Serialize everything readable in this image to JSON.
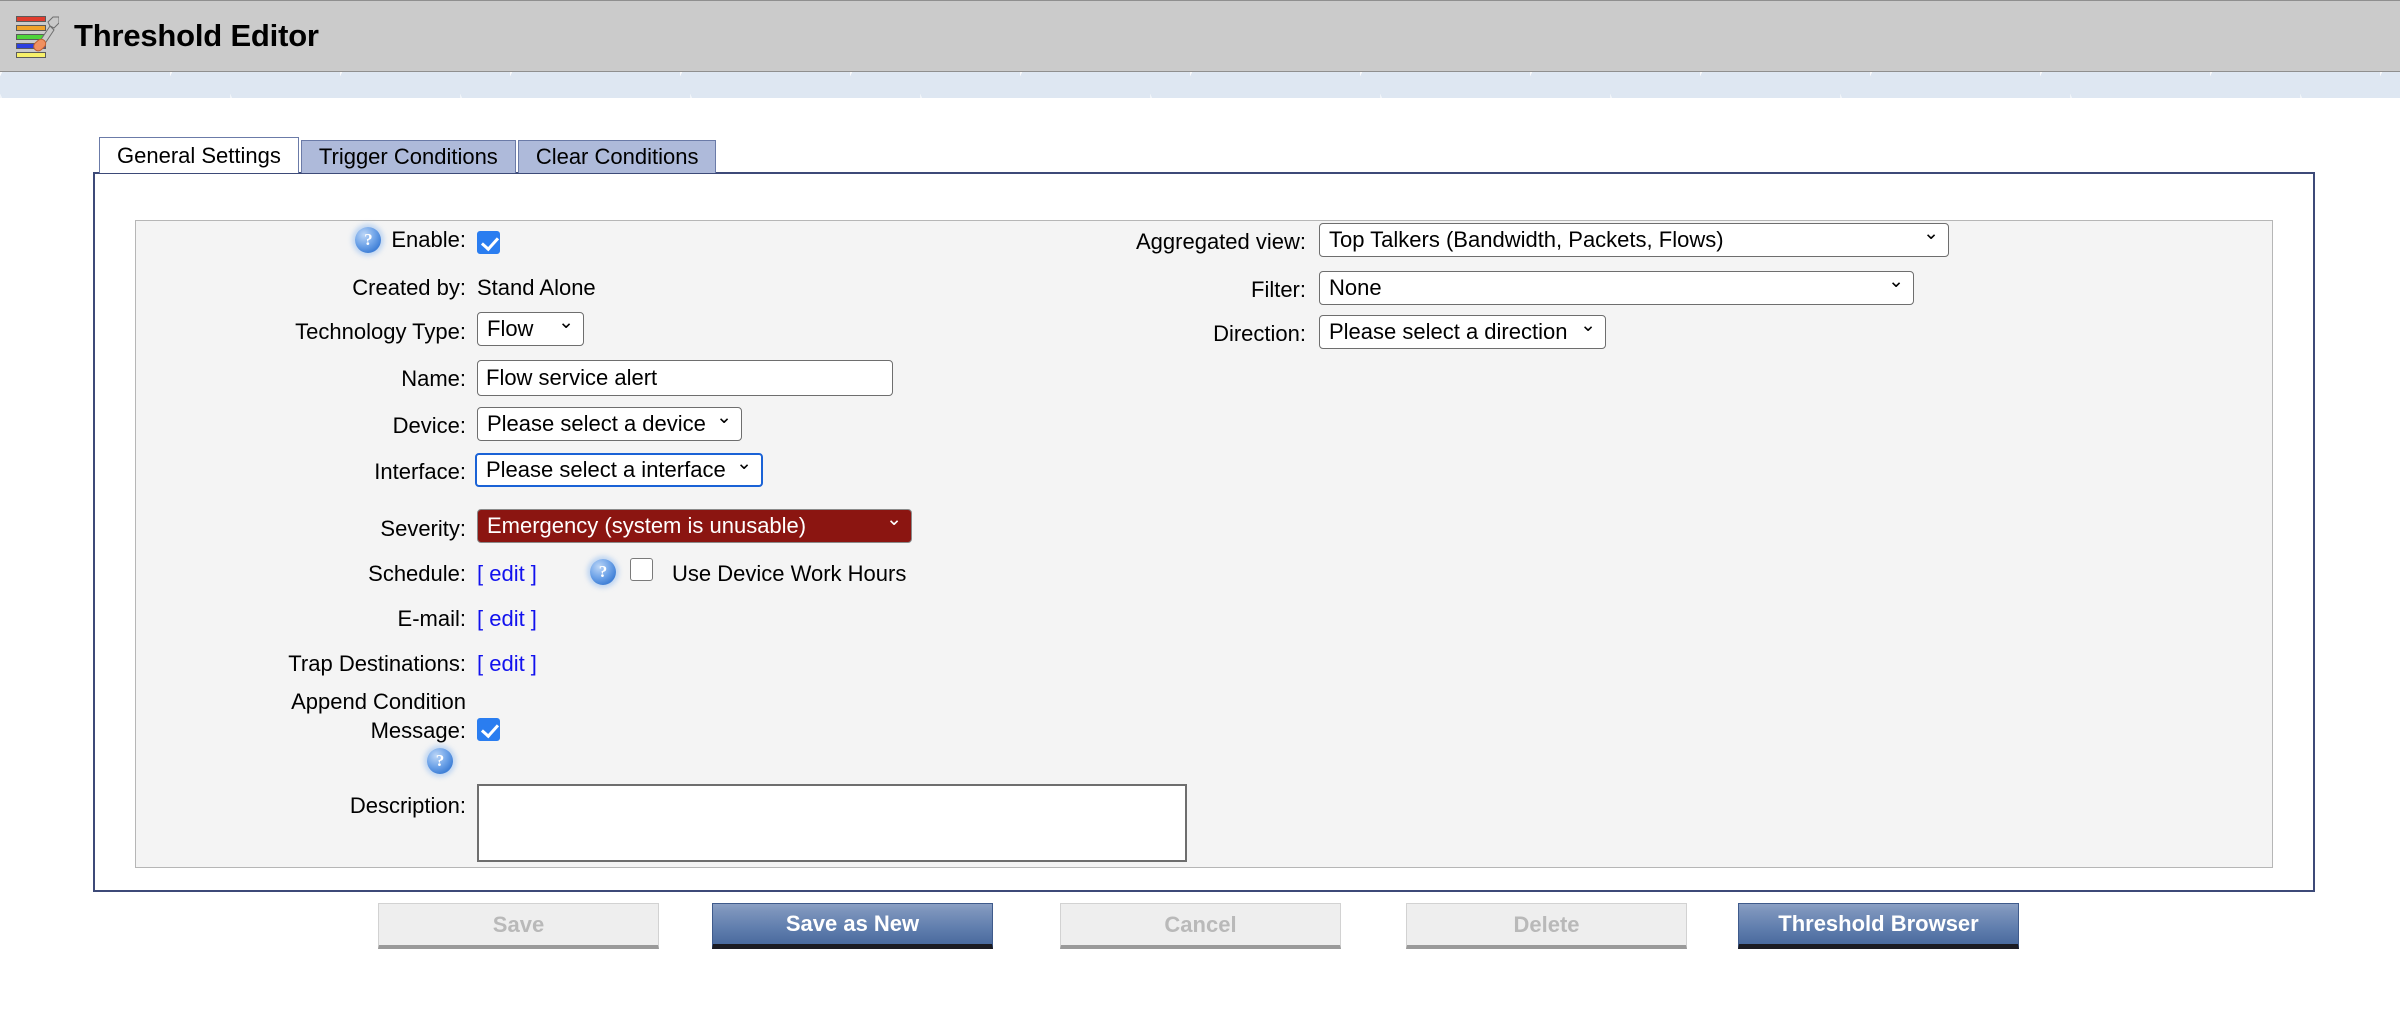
{
  "window": {
    "title": "Threshold Editor",
    "icon": "threshold-editor-icon"
  },
  "tabs": [
    {
      "label": "General Settings",
      "active": true
    },
    {
      "label": "Trigger Conditions",
      "active": false
    },
    {
      "label": "Clear Conditions",
      "active": false
    }
  ],
  "form": {
    "left": {
      "enable": {
        "label": "Enable:",
        "checked": true,
        "help": "help-icon"
      },
      "created_by": {
        "label": "Created by:",
        "value": "Stand Alone"
      },
      "technology_type": {
        "label": "Technology Type:",
        "value": "Flow"
      },
      "name": {
        "label": "Name:",
        "value": "Flow service alert",
        "placeholder": ""
      },
      "device": {
        "label": "Device:",
        "value": "Please select a device"
      },
      "interface": {
        "label": "Interface:",
        "value": "Please select a interface",
        "focused": true
      },
      "severity": {
        "label": "Severity:",
        "value": "Emergency (system is unusable)",
        "color": "#8b1511"
      },
      "schedule": {
        "label": "Schedule:",
        "edit_link": "[ edit ]",
        "work_hours_label": "Use Device Work Hours",
        "work_hours_checked": false
      },
      "email": {
        "label": "E-mail:",
        "edit_link": "[ edit ]"
      },
      "trap_destinations": {
        "label": "Trap Destinations:",
        "edit_link": "[ edit ]"
      },
      "append_condition_message": {
        "label_line1": "Append Condition",
        "label_line2": "Message:",
        "checked": true
      },
      "description": {
        "label": "Description:",
        "value": "",
        "placeholder": ""
      }
    },
    "right": {
      "aggregated_view": {
        "label": "Aggregated view:",
        "value": "Top Talkers (Bandwidth, Packets, Flows)"
      },
      "filter": {
        "label": "Filter:",
        "value": "None"
      },
      "direction": {
        "label": "Direction:",
        "value": "Please select a direction"
      }
    }
  },
  "buttons": [
    {
      "label": "Save",
      "state": "disabled"
    },
    {
      "label": "Save as New",
      "state": "primary"
    },
    {
      "label": "Cancel",
      "state": "disabled"
    },
    {
      "label": "Delete",
      "state": "disabled"
    },
    {
      "label": "Threshold Browser",
      "state": "primary"
    }
  ],
  "colors": {
    "titlebar": "#cbcbcb",
    "accent_blue": "#5f7dad",
    "severity_red": "#8b1511",
    "link_blue": "#1111ee",
    "container_border": "#3d4a78",
    "tab_inactive": "#aebada"
  }
}
